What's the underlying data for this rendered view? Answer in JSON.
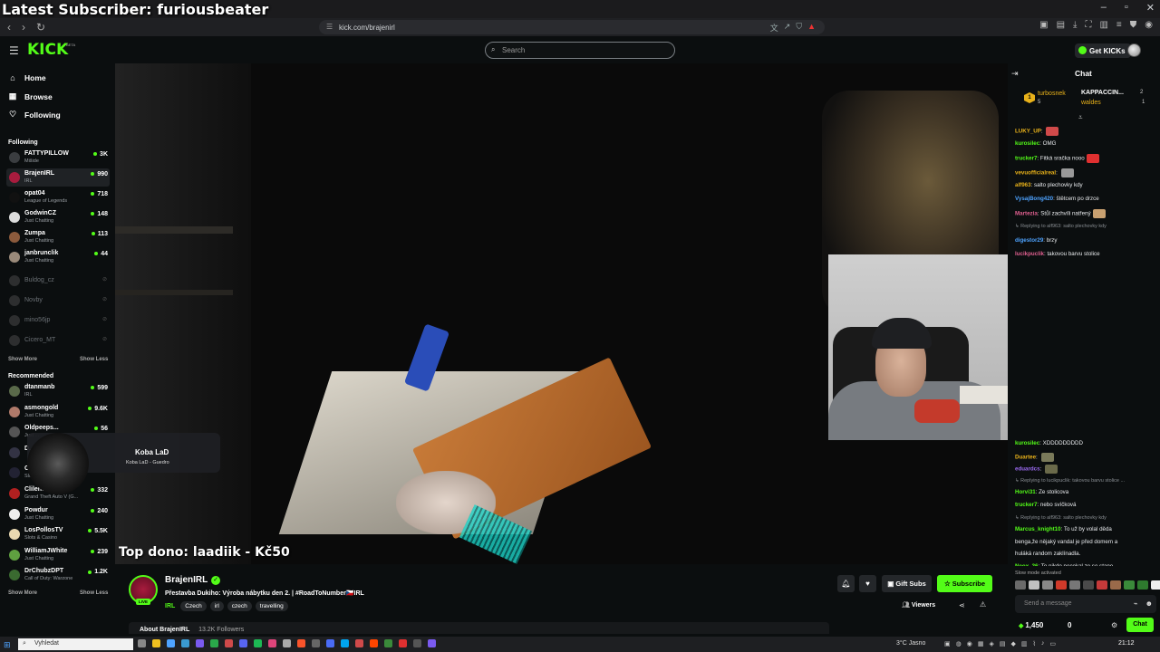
{
  "overlay": {
    "latest_subscriber": "Latest Subscriber: furiousbeater"
  },
  "browser": {
    "url": "kick.com/brajenirl"
  },
  "header": {
    "logo": "KICK",
    "logo_badge": "BETA",
    "search_placeholder": "Search",
    "get_kicks": "Get KICKs"
  },
  "nav": {
    "home": "Home",
    "browse": "Browse",
    "following": "Following"
  },
  "sidebar": {
    "following_title": "Following",
    "following": [
      {
        "name": "FATTYPILLOW",
        "category": "Mišide",
        "viewers": "3K",
        "color": "#3a3d40"
      },
      {
        "name": "BrajenIRL",
        "category": "IRL",
        "viewers": "990",
        "color": "#a81c3e"
      },
      {
        "name": "opat04",
        "category": "League of Legends",
        "viewers": "718",
        "color": "#111"
      },
      {
        "name": "GodwinCZ",
        "category": "Just Chatting",
        "viewers": "148",
        "color": "#ddd"
      },
      {
        "name": "Zumpa",
        "category": "Just Chatting",
        "viewers": "113",
        "color": "#8b5a3c"
      },
      {
        "name": "janbrunclik",
        "category": "Just Chatting",
        "viewers": "44",
        "color": "#9a8a7a"
      }
    ],
    "offline": [
      "Buldog_cz",
      "Novby",
      "mino56jp",
      "Cicero_MT"
    ],
    "show_more": "Show More",
    "show_less": "Show Less",
    "recommended_title": "Recommended",
    "recommended": [
      {
        "name": "dtanmanb",
        "category": "IRL",
        "viewers": "599",
        "color": "#5a6a4a"
      },
      {
        "name": "asmongold",
        "category": "Just Chatting",
        "viewers": "9.6K",
        "color": "#b07a6a"
      },
      {
        "name": "Oldpeeps...",
        "category": "Just ...",
        "viewers": "56",
        "color": "#555"
      },
      {
        "name": "D...",
        "category": "",
        "viewers": "",
        "color": "#334"
      },
      {
        "name": "Cl...",
        "category": "Slots ...",
        "viewers": "",
        "color": "#223"
      },
      {
        "name": "Clilent",
        "category": "Grand Theft Auto V (G...",
        "viewers": "332",
        "color": "#b02020"
      },
      {
        "name": "Powdur",
        "category": "Just Chatting",
        "viewers": "240",
        "color": "#eee"
      },
      {
        "name": "LosPollosTV",
        "category": "Slots & Casino",
        "viewers": "5.5K",
        "color": "#e8d8b0"
      },
      {
        "name": "WilliamJWhite",
        "category": "Just Chatting",
        "viewers": "239",
        "color": "#5fa040"
      },
      {
        "name": "DrChubzDPT",
        "category": "Call of Duty: Warzone",
        "viewers": "1.2K",
        "color": "#3a6a30"
      }
    ]
  },
  "video": {
    "top_dono": "Top dono: laadiik - Kč50",
    "song_title": "Koba LaD",
    "song_sub": "Koba LaD - Guedro"
  },
  "stream": {
    "streamer": "BrajenIRL",
    "live": "LIVE",
    "title": "Přestavba Dukiho: Výroba nábytku den 2. | #RoadToNumber🇨🇿IRL",
    "category": "IRL",
    "tags": [
      "Czech",
      "irl",
      "czech",
      "travelling"
    ],
    "gift_subs": "Gift Subs",
    "subscribe": "Subscribe",
    "viewers": "Viewers",
    "about": "About BrajenIRL",
    "followers": "13.2K Followers"
  },
  "chat": {
    "title": "Chat",
    "leaderboard": [
      {
        "name": "turbosnek",
        "count": "5",
        "rank": "1"
      },
      {
        "name": "KAPPACCIN...",
        "count": "2"
      },
      {
        "name": "waldes",
        "count": "1"
      }
    ],
    "messages_top": [
      {
        "user": "LUKY_UP",
        "text": "",
        "color": "#e8b11a",
        "emote": "#d04a4a"
      },
      {
        "user": "kurosilec",
        "text": "OMG",
        "color": "#53fc18"
      },
      {
        "user": "trucker7",
        "text": "Fitká sračka nooo",
        "color": "#53fc18",
        "emote": "#e03030"
      },
      {
        "user": "vevuofficialreal",
        "text": "",
        "color": "#e8b11a",
        "emote": "#999"
      },
      {
        "user": "alf963",
        "text": "salto plechovky kdy",
        "color": "#e8b11a"
      },
      {
        "user": "VysajBong420",
        "text": "štětcem po drzce",
        "color": "#4ea3ff"
      },
      {
        "user": "Martezia",
        "text": "Stůl zachvíli natřený",
        "color": "#e06090",
        "emote": "#c8a070"
      },
      {
        "user": "",
        "text": "↳ Replying to alf963: salto plechovky kdy",
        "color": "#888",
        "reply": true
      },
      {
        "user": "digestor29",
        "text": "brzy",
        "color": "#4ea3ff"
      },
      {
        "user": "lucikpuclik",
        "text": "takovou barvu stolice",
        "color": "#e06090"
      }
    ],
    "messages_bottom": [
      {
        "user": "kurosilec",
        "text": "XDDDDDDDDD",
        "color": "#53fc18"
      },
      {
        "user": "Duartee",
        "text": "",
        "color": "#e8b11a",
        "emote": "#7a7a5a"
      },
      {
        "user": "eduardcs",
        "text": "",
        "color": "#9a6af0",
        "emote": "#6a6a4a"
      },
      {
        "user": "",
        "text": "↳ Replying to lucikpuclik: takovou barvu stolice ...",
        "color": "#888",
        "reply": true
      },
      {
        "user": "Horvi31",
        "text": "Ze stolicova",
        "color": "#53fc18"
      },
      {
        "user": "trucker7",
        "text": "nebo svíčková",
        "color": "#53fc18"
      },
      {
        "user": "",
        "text": "↳ Replying to alf963: salto plechovky kdy",
        "color": "#888",
        "reply": true
      },
      {
        "user": "Marcus_knight10",
        "text": "To už by volal děda",
        "color": "#53fc18"
      },
      {
        "user": "",
        "text": "benga,že nějaký vandal je před domem a",
        "color": "#e9ebee"
      },
      {
        "user": "",
        "text": "huláká random zaklínadla.",
        "color": "#e9ebee"
      },
      {
        "user": "Neox_36",
        "text": "To nikdo necekal ze se stane",
        "color": "#53fc18"
      }
    ],
    "slow_mode": "Slow mode activated",
    "send_placeholder": "Send a message",
    "kicks_balance": "1,450",
    "zero": "0",
    "chat_button": "Chat"
  },
  "taskbar": {
    "search": "Vyhledat",
    "weather": "3°C  Jasno",
    "clock": "21:12"
  }
}
